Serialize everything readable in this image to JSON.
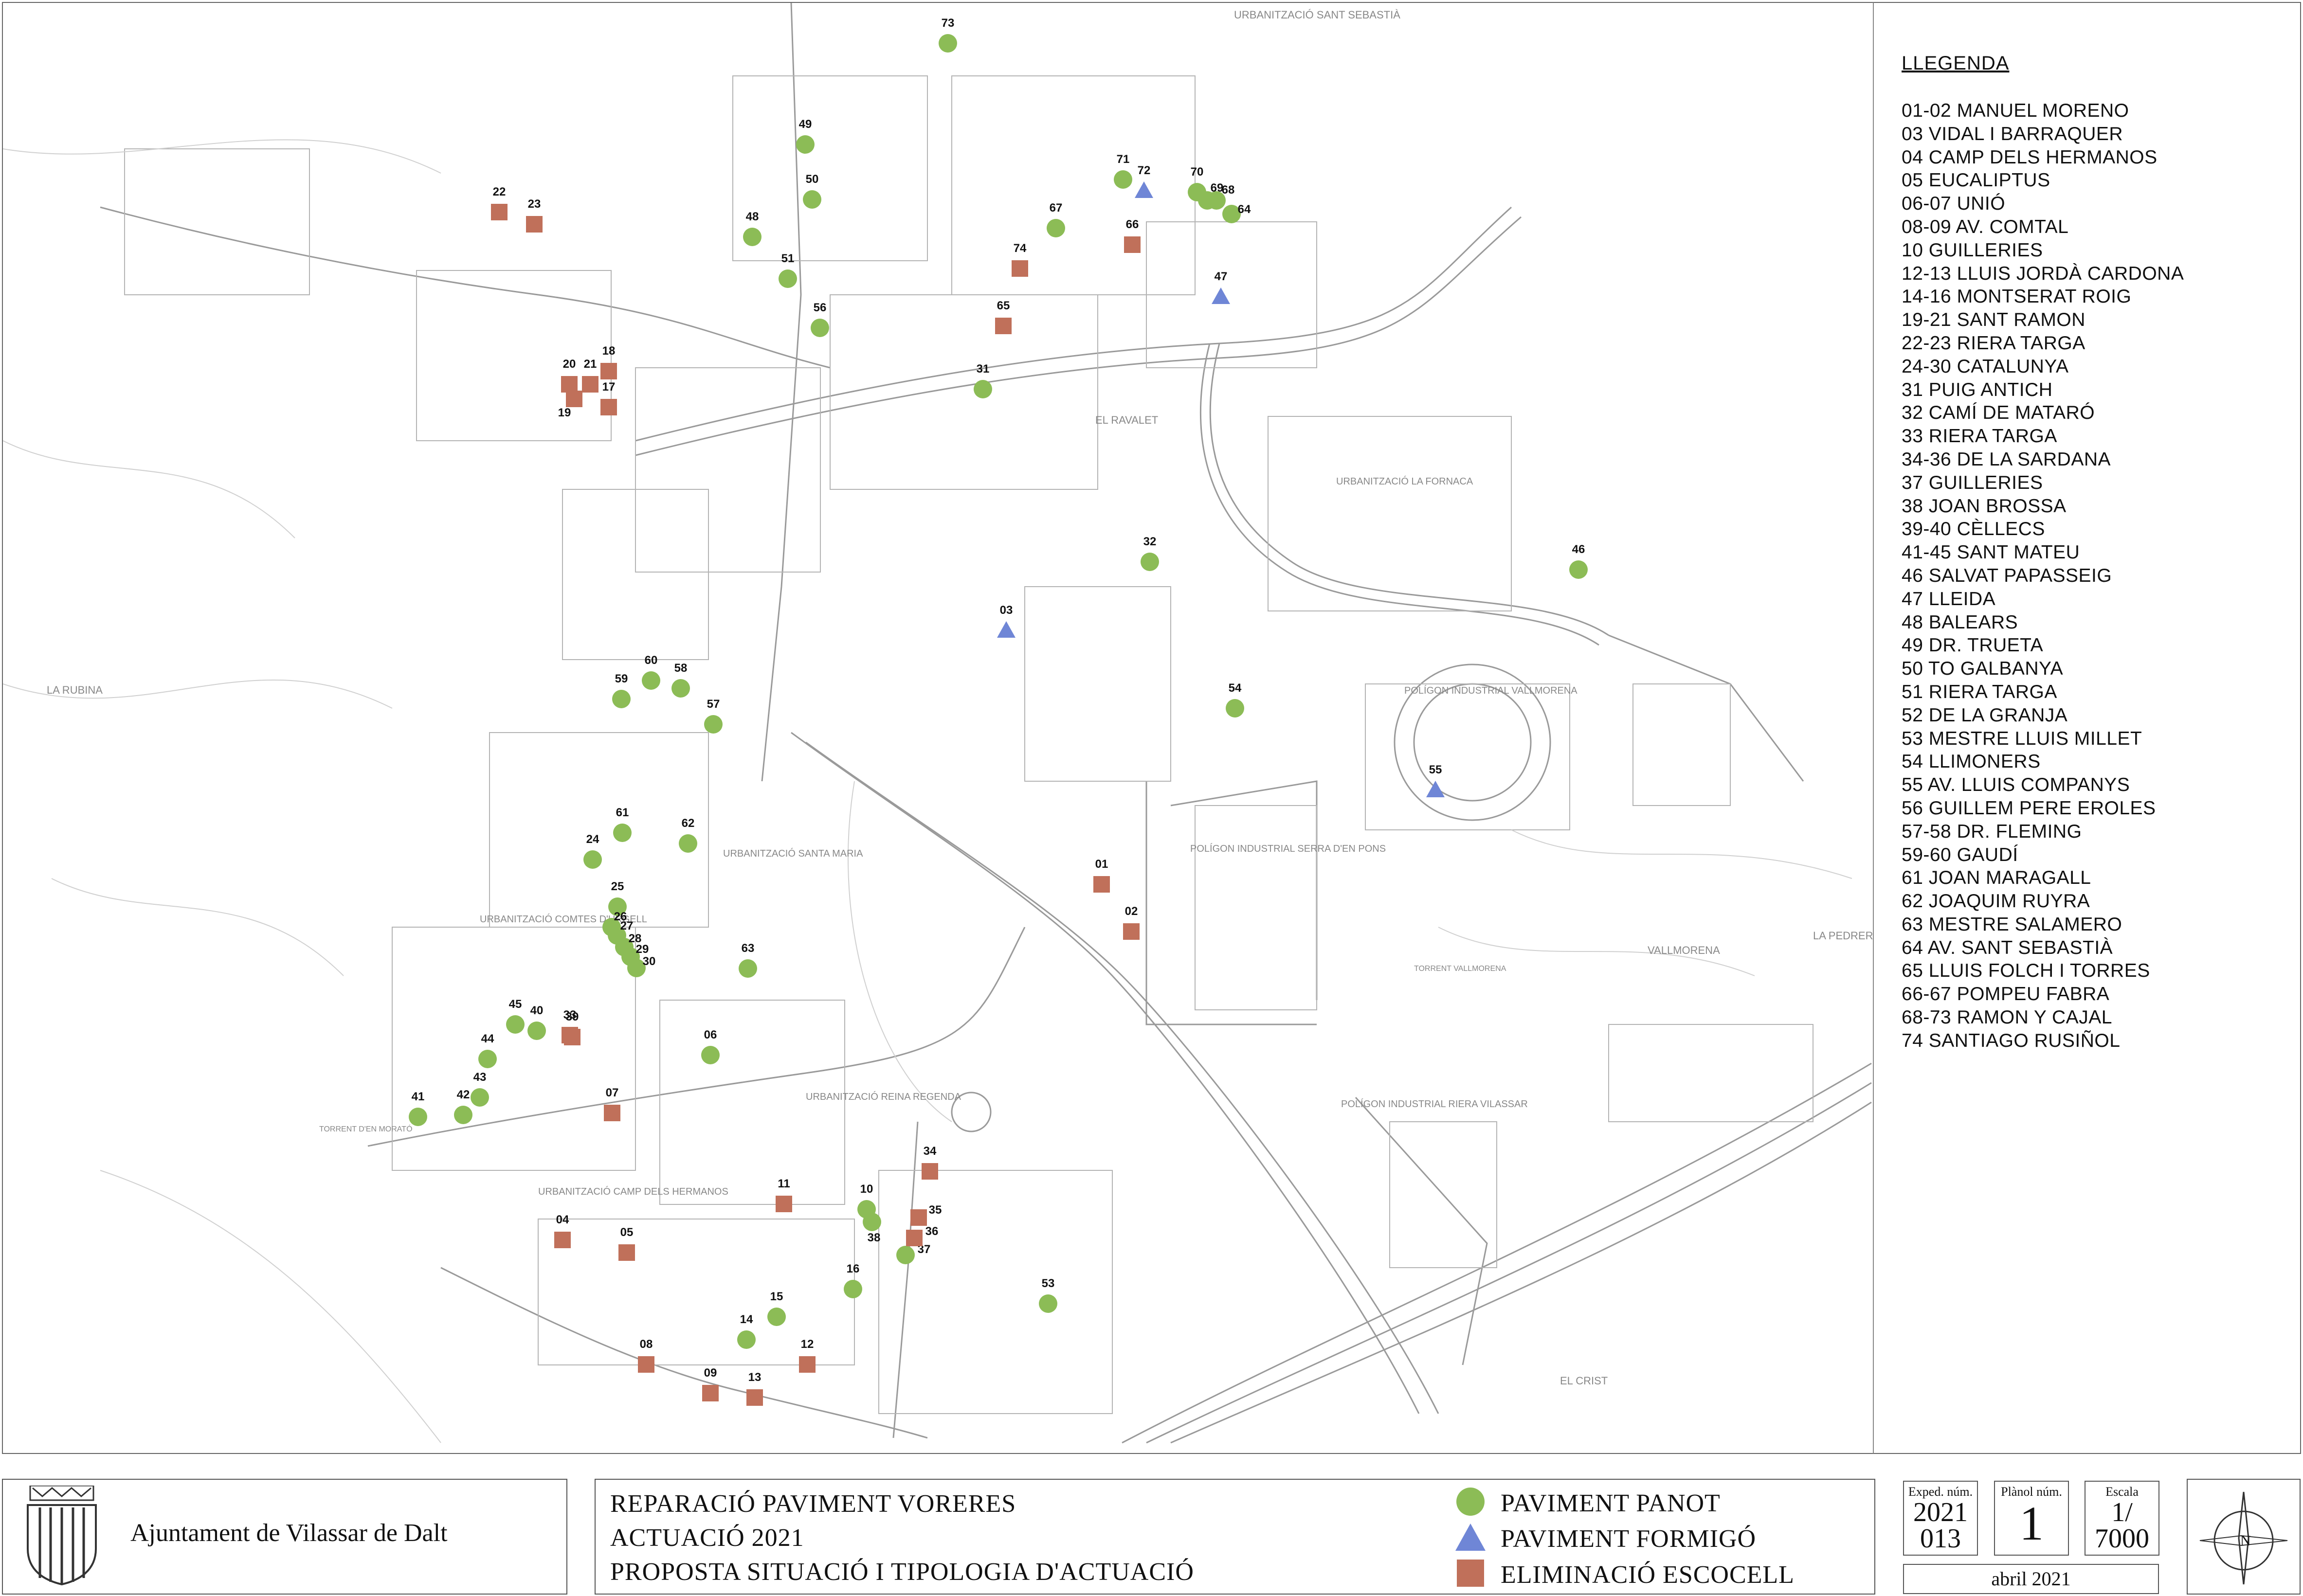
{
  "legend": {
    "title": "LLEGENDA",
    "items": [
      "01-02 MANUEL MORENO",
      "03 VIDAL I BARRAQUER",
      "04 CAMP DELS HERMANOS",
      "05 EUCALIPTUS",
      "06-07 UNIÓ",
      "08-09 AV. COMTAL",
      "10 GUILLERIES",
      "12-13 LLUIS JORDÀ CARDONA",
      "14-16 MONTSERAT ROIG",
      "19-21 SANT RAMON",
      "22-23 RIERA TARGA",
      "24-30 CATALUNYA",
      "31 PUIG ANTICH",
      "32 CAMÍ DE MATARÓ",
      "33 RIERA TARGA",
      "34-36 DE LA SARDANA",
      "37 GUILLERIES",
      "38 JOAN BROSSA",
      "39-40 CÈLLECS",
      "41-45 SANT MATEU",
      "46 SALVAT PAPASSEIG",
      "47 LLEIDA",
      "48 BALEARS",
      "49 DR. TRUETA",
      "50 TO GALBANYA",
      "51 RIERA TARGA",
      "52 DE LA GRANJA",
      "53 MESTRE LLUIS MILLET",
      "54 LLIMONERS",
      "55 AV. LLUIS COMPANYS",
      "56 GUILLEM PERE EROLES",
      "57-58 DR. FLEMING",
      "59-60 GAUDÍ",
      "61 JOAN MARAGALL",
      "62 JOAQUIM RUYRA",
      "63 MESTRE SALAMERO",
      "64 AV. SANT SEBASTIÀ",
      "65 LLUIS FOLCH I TORRES",
      "66-67 POMPEU FABRA",
      "68-73 RAMON Y CAJAL",
      "74 SANTIAGO RUSIÑOL"
    ]
  },
  "map_labels": [
    "URBANITZACIÓ SANT SEBASTIÀ",
    "EL RAVALET",
    "URBANITZACIÓ LA FORNACA",
    "POLÍGON INDUSTRIAL VALLMORENA",
    "POLÍGON INDUSTRIAL SERRA D'EN PONS",
    "POLÍGON INDUSTRIAL RIERA VILASSAR",
    "URBANITZACIÓ COMTES D'URGELL",
    "URBANITZACIÓ SANTA MARIA",
    "URBANITZACIÓ REINA REGENDA",
    "URBANITZACIÓ CAMP DELS HERMANOS",
    "LA RUBINA",
    "LA PEDRERA",
    "VALLMORENA",
    "EL CRIST",
    "TORRENT VALLMORENA",
    "TORRENT D'EN MORATÓ"
  ],
  "markers": {
    "panot": [
      "06",
      "10",
      "14",
      "15",
      "16",
      "24",
      "25",
      "26",
      "27",
      "28",
      "29",
      "30",
      "31",
      "32",
      "37",
      "38",
      "40",
      "41",
      "42",
      "43",
      "44",
      "45",
      "46",
      "48",
      "49",
      "50",
      "51",
      "53",
      "54",
      "56",
      "57",
      "58",
      "59",
      "60",
      "61",
      "62",
      "63",
      "64",
      "67",
      "68",
      "69",
      "70",
      "71",
      "73"
    ],
    "formigo": [
      "03",
      "47",
      "55",
      "72"
    ],
    "escocell": [
      "01",
      "02",
      "04",
      "05",
      "07",
      "08",
      "09",
      "11",
      "12",
      "13",
      "17",
      "18",
      "19",
      "20",
      "21",
      "22",
      "23",
      "33",
      "34",
      "35",
      "36",
      "39",
      "65",
      "66",
      "74"
    ]
  },
  "organization": "Ajuntament de Vilassar de Dalt",
  "title_lines": [
    "REPARACIÓ PAVIMENT VORERES",
    "ACTUACIÓ 2021",
    "PROPOSTA SITUACIÓ I TIPOLOGIA D'ACTUACIÓ"
  ],
  "key": {
    "panot": "PAVIMENT PANOT",
    "formigo": "PAVIMENT FORMIGÓ",
    "escocell": "ELIMINACIÓ ESCOCELL"
  },
  "colors": {
    "panot": "#8cbc56",
    "formigo": "#6f86d6",
    "escocell": "#c0705a",
    "streets": "#9a9a9a"
  },
  "cartouche": {
    "exped_label": "Exped. núm.",
    "exped_value": "2021 013",
    "exped_value_line1": "2021",
    "exped_value_line2": "013",
    "plano_label": "Plànol núm.",
    "plano_value": "1",
    "escala_label": "Escala",
    "escala_value_line1": "1/",
    "escala_value_line2": "7000",
    "date": "abril 2021"
  }
}
